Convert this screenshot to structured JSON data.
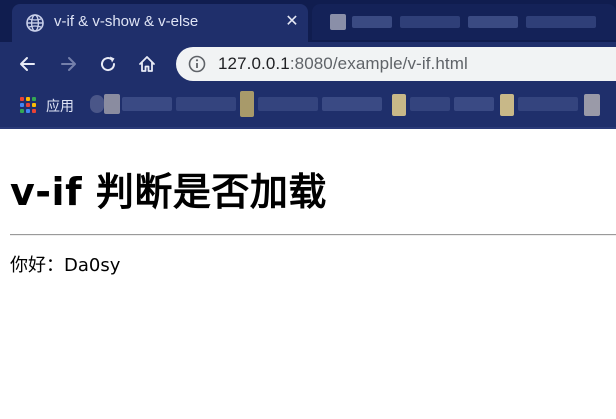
{
  "browser": {
    "tab": {
      "title": "v-if & v-show & v-else",
      "close_glyph": "✕",
      "favicon_icon": "globe-icon"
    },
    "toolbar": {
      "back_icon": "back-arrow-icon",
      "forward_icon": "forward-arrow-icon",
      "reload_icon": "reload-icon",
      "home_icon": "home-icon",
      "info_icon": "info-icon"
    },
    "address_bar": {
      "host": "127.0.0.1",
      "rest": ":8080/example/v-if.html"
    },
    "bookmarks": {
      "apps_label": "应用",
      "apps_icon": "apps-grid-icon"
    },
    "colors": {
      "chrome_bg": "#1f2f6b",
      "tabstrip_bg": "#101d4f",
      "omnibox_bg": "#f1f3f4"
    }
  },
  "page": {
    "title": "v-if 判断是否加载",
    "greeting": "你好：Da0sy"
  }
}
